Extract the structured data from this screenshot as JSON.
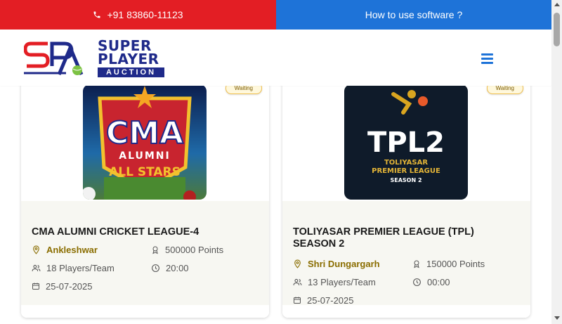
{
  "topbar": {
    "phone": "+91 83860-11123",
    "howto": "How to use software ?"
  },
  "header": {
    "logo_line1": "SUPER",
    "logo_line2": "PLAYER",
    "logo_line3": "AUCTION"
  },
  "cards": [
    {
      "status": "Waiting",
      "logo_line1": "CMA",
      "logo_line2": "ALUMNI",
      "logo_line3": "ALL STARS",
      "title": "CMA ALUMNI CRICKET LEAGUE-4",
      "location": "Ankleshwar",
      "points": "500000 Points",
      "players": "18 Players/Team",
      "time": "20:00",
      "date": "25-07-2025"
    },
    {
      "status": "Waiting",
      "logo_line1": "TPL2",
      "logo_line2": "TOLIYASAR",
      "logo_line3": "PREMIER LEAGUE",
      "logo_line4": "SEASON 2",
      "title": "TOLIYASAR PREMIER LEAGUE (TPL) SEASON 2",
      "location": "Shri Dungargarh",
      "points": "150000 Points",
      "players": "13 Players/Team",
      "time": "00:00",
      "date": "25-07-2025"
    }
  ],
  "colors": {
    "red": "#e31e24",
    "blue": "#1e73d8",
    "brand_navy": "#1f2a8a",
    "location_gold": "#8a6d00"
  },
  "icons": [
    "phone-icon",
    "menu-icon",
    "location-icon",
    "trophy-icon",
    "users-icon",
    "clock-icon",
    "calendar-icon"
  ]
}
